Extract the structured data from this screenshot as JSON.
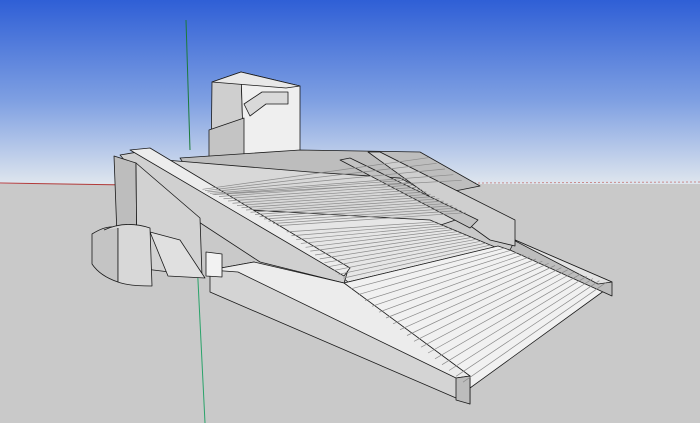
{
  "app": {
    "kind": "3d-modeling-viewport"
  },
  "viewport": {
    "sky_top_color": "#3a6ad8",
    "sky_horizon_color": "#d9e2ec",
    "ground_color": "#c8c8c8",
    "axis_colors": {
      "red": "#b23a3a",
      "green": "#2aa36a",
      "blue": "#1c3fbf"
    }
  },
  "model": {
    "surface_colors": {
      "light": "#ededed",
      "mid": "#d6d6d6",
      "shade": "#bdbdbd",
      "dark": "#9b9b9b",
      "edge": "#1a1a1a"
    }
  }
}
